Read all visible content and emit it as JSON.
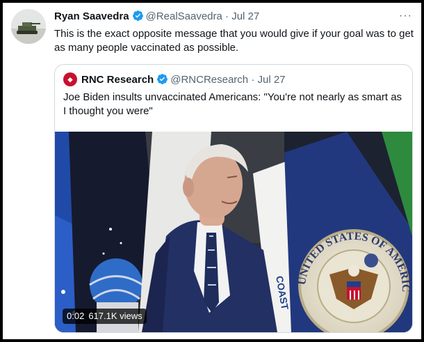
{
  "tweet": {
    "author_name": "Ryan Saavedra",
    "handle": "@RealSaavedra",
    "separator": "·",
    "date": "Jul 27",
    "more_label": "···",
    "text": "This is the exact opposite message that you would give if your goal was to get as many people vaccinated as possible."
  },
  "quoted_tweet": {
    "author_name": "RNC Research",
    "handle": "@RNCResearch",
    "separator": "·",
    "date": "Jul 27",
    "text": "Joe Biden insults unvaccinated Americans: \"You're not nearly as smart as I thought you were\"",
    "media": {
      "duration": "0:02",
      "views": "617.1K views",
      "seal_text": "UNITED STATES OF AMERICA",
      "flag_text": "COAST"
    }
  },
  "colors": {
    "verified": "#1d9bf0",
    "primary_text": "#0f1419",
    "secondary_text": "#536471",
    "border": "#cfd9de"
  },
  "icons": [
    "verified-icon",
    "more-icon",
    "rnc-logo-icon"
  ]
}
